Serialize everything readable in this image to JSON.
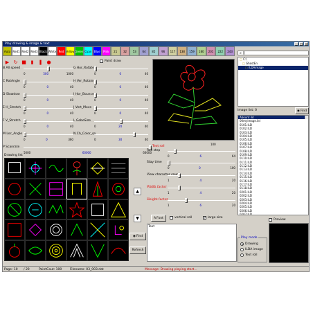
{
  "window": {
    "title": "Play drawing & image & text"
  },
  "palette": [
    {
      "label": "Auto",
      "bg": "#c0c000",
      "fg": "#000"
    },
    {
      "label": "Red1",
      "bg": "#ffffff",
      "fg": "#000"
    },
    {
      "label": "Red2",
      "bg": "#ffffff",
      "fg": "#000"
    },
    {
      "label": "Red3",
      "bg": "#ffffff",
      "fg": "#000"
    },
    {
      "label": "Black",
      "bg": "#000000",
      "fg": "#fff"
    },
    {
      "label": "White",
      "bg": "#ffffff",
      "fg": "#000"
    },
    {
      "label": "Red",
      "bg": "#ff0000",
      "fg": "#fff"
    },
    {
      "label": "Yellow",
      "bg": "#ffff00",
      "fg": "#000"
    },
    {
      "label": "Green",
      "bg": "#00c000",
      "fg": "#fff"
    },
    {
      "label": "Cyan",
      "bg": "#00ffff",
      "fg": "#000"
    },
    {
      "label": "Blue",
      "bg": "#0000ff",
      "fg": "#fff"
    },
    {
      "label": "Pink",
      "bg": "#ff00ff",
      "fg": "#fff"
    },
    {
      "label": "21",
      "bg": "#c8c890",
      "fg": "#000"
    },
    {
      "label": "32",
      "bg": "#d8a0a0",
      "fg": "#000"
    },
    {
      "label": "53",
      "bg": "#a0c8a0",
      "fg": "#000"
    },
    {
      "label": "64",
      "bg": "#a0a0d0",
      "fg": "#000"
    },
    {
      "label": "85",
      "bg": "#a0d0d0",
      "fg": "#000"
    },
    {
      "label": "96",
      "bg": "#c0a0d0",
      "fg": "#000"
    },
    {
      "label": "117",
      "bg": "#d0d0a0",
      "fg": "#000"
    },
    {
      "label": "138",
      "bg": "#d0b080",
      "fg": "#000"
    },
    {
      "label": "159",
      "bg": "#90b0d0",
      "fg": "#000"
    },
    {
      "label": "180",
      "bg": "#b0d090",
      "fg": "#000"
    },
    {
      "label": "201",
      "bg": "#d090b0",
      "fg": "#000"
    },
    {
      "label": "222",
      "bg": "#90d0b0",
      "fg": "#000"
    },
    {
      "label": "243",
      "bg": "#b090d0",
      "fg": "#000"
    }
  ],
  "toolbar": {
    "paint_draw_label": "Paint draw"
  },
  "params": [
    {
      "label": "B All speed",
      "min": "0",
      "value": "500",
      "max": "1000"
    },
    {
      "label": "G Hor_Rotate",
      "min": "0",
      "value": "0",
      "max": "40"
    },
    {
      "label": "C RotAngle",
      "min": "0",
      "value": "0",
      "max": "40"
    },
    {
      "label": "H Ver_Rotate",
      "min": "0",
      "value": "0",
      "max": "40"
    },
    {
      "label": "D Slowdow",
      "min": "0",
      "value": "0",
      "max": "40"
    },
    {
      "label": "I Hor_Bounce",
      "min": "0",
      "value": "0",
      "max": "40"
    },
    {
      "label": "E H_Stretch",
      "min": "0",
      "value": "0",
      "max": "40"
    },
    {
      "label": "J Vert_Move",
      "min": "0",
      "value": "0",
      "max": "40"
    },
    {
      "label": "F V_Stretch",
      "min": "0",
      "value": "0",
      "max": "40"
    },
    {
      "label": "L GoboSize",
      "min": "0",
      "value": "20",
      "max": "40"
    },
    {
      "label": "M Loc_Angle",
      "min": "0",
      "value": "0",
      "max": "360"
    },
    {
      "label": "N Ch_Color_sp",
      "min": "0",
      "value": "30",
      "max": "40"
    }
  ],
  "scanrate": {
    "label": "P Scanrate",
    "min": "5000",
    "value": "60000",
    "max": "60000"
  },
  "preview": {
    "number": "100"
  },
  "drawing_list": {
    "label": "Drawing list"
  },
  "buttons": {
    "find": "Find",
    "refresh": "Refresh",
    "font": "Font",
    "find2": "Find",
    "up": "▲",
    "down": "▼"
  },
  "text_roll": {
    "title": "Text roll",
    "roll_step": {
      "label": "Roll step",
      "min": "0",
      "value": "6",
      "max": "64"
    },
    "stay_time": {
      "label": "Stay time",
      "min": "0",
      "value": "0",
      "max": "100"
    },
    "view_count": {
      "label": "View character count",
      "min": "1",
      "value": "4",
      "max": "20"
    },
    "width_factor": {
      "label": "Width factor",
      "min": "1",
      "value": "4",
      "max": "20"
    },
    "height_factor": {
      "label": "Height factor",
      "min": "1",
      "value": "6",
      "max": "20"
    },
    "vertical_roll": "vertical roll",
    "large_size": "large size",
    "text_label": "Text"
  },
  "directory": {
    "combo": "c: []",
    "tree": [
      "C:\\",
      "GhostEn",
      "ILDAimage"
    ]
  },
  "image_list": {
    "label": "Image list: 0",
    "files": [
      "Abount ild",
      "00myimage.ild",
      "0101.ILD",
      "0102.ILD",
      "0103.ILD",
      "0104.ILD",
      "0105.ILD",
      "0106.ILD",
      "0107.ILD",
      "0108.ILD",
      "0109.ILD",
      "0110.ILD",
      "0111.ILD",
      "0112.ILD",
      "0113.ILD",
      "0114.ILD",
      "0115.ILD",
      "0116.ILD",
      "0117.ILD",
      "0118.ILD",
      "0201.ILD",
      "0202.ILD",
      "0203.ILD",
      "0204.ILD",
      "0205.ILD",
      "0206.ILD",
      "0207.ILD"
    ]
  },
  "preview_check": "Preview",
  "play_mode": {
    "title": "Play mode",
    "options": [
      "Drawing",
      "ILDA image",
      "Text roll"
    ]
  },
  "status": {
    "page_label": "Page: 10",
    "page_total": "/ 20",
    "point_count": "PointCout:   100",
    "filename": "Filename:    03_003.dat",
    "message": "Message: Drawing playing start..."
  },
  "colors": {
    "accent": "#0a246a",
    "value_blue": "#0000c0",
    "title_red": "#e00000"
  }
}
